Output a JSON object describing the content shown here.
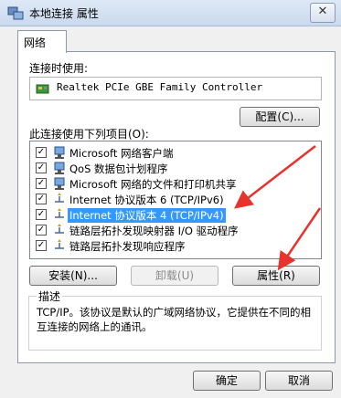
{
  "window": {
    "title": "本地连接 属性",
    "close_symbol": "✕"
  },
  "tabs": [
    {
      "label": "网络"
    }
  ],
  "connect_using": {
    "label": "连接时使用:",
    "adapter": "Realtek PCIe GBE Family Controller",
    "configure_button": "配置(C)..."
  },
  "items": {
    "label": "此连接使用下列项目(O):",
    "list": [
      {
        "label": "Microsoft 网络客户端",
        "checked": true,
        "icon": "network-client-icon"
      },
      {
        "label": "QoS 数据包计划程序",
        "checked": true,
        "icon": "qos-scheduler-icon"
      },
      {
        "label": "Microsoft 网络的文件和打印机共享",
        "checked": true,
        "icon": "file-printer-sharing-icon"
      },
      {
        "label": "Internet 协议版本 6 (TCP/IPv6)",
        "checked": true,
        "icon": "protocol-icon"
      },
      {
        "label": "Internet 协议版本 4 (TCP/IPv4)",
        "checked": true,
        "icon": "protocol-icon",
        "selected": true
      },
      {
        "label": "链路层拓扑发现映射器 I/O 驱动程序",
        "checked": true,
        "icon": "protocol-icon"
      },
      {
        "label": "链路层拓扑发现响应程序",
        "checked": true,
        "icon": "protocol-icon"
      }
    ]
  },
  "buttons": {
    "install": "安装(N)...",
    "uninstall": "卸载(U)",
    "properties": "属性(R)"
  },
  "description": {
    "legend": "描述",
    "text": "TCP/IP。该协议是默认的广域网络协议，它提供在不同的相互连接的网络上的通讯。"
  },
  "footer": {
    "ok": "确定",
    "cancel": "取消"
  },
  "colors": {
    "selection": "#3399ff",
    "annotation_arrow": "#e8322c"
  }
}
